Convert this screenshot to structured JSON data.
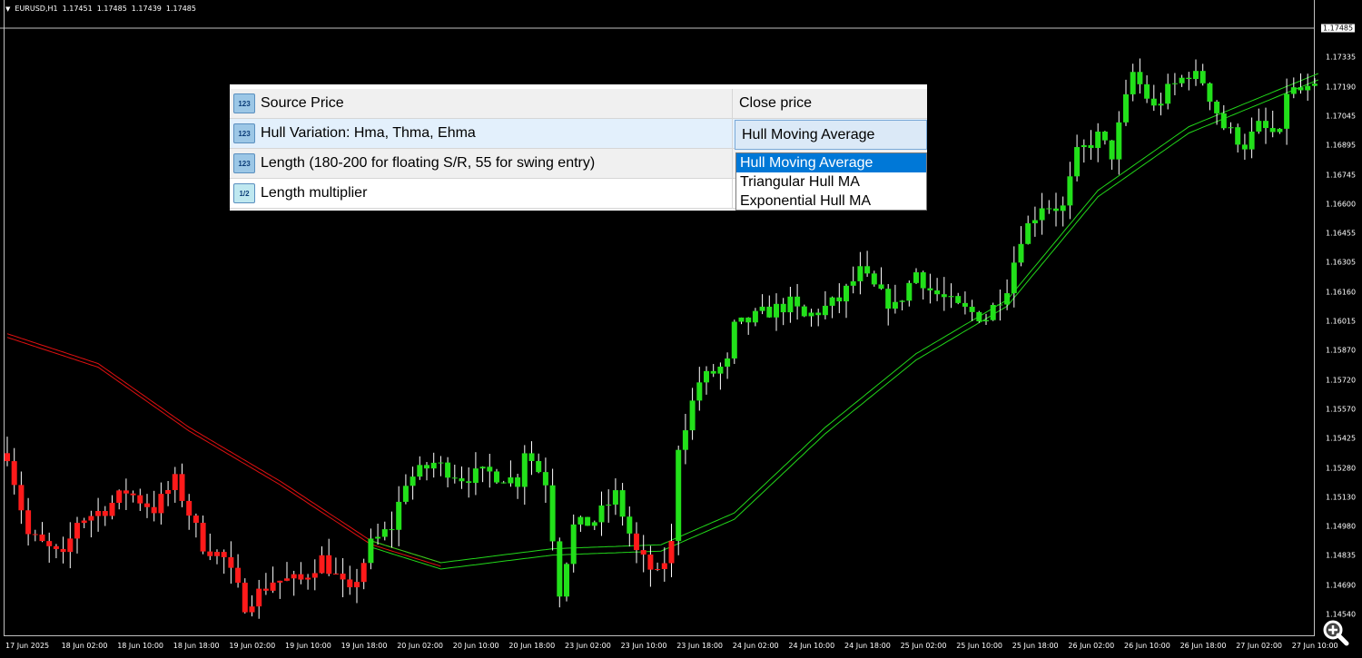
{
  "header": {
    "symbol": "EURUSD,H1",
    "open": "1.17451",
    "high": "1.17485",
    "low": "1.17439",
    "close": "1.17485"
  },
  "price_axis": {
    "current": "1.17485",
    "labels": [
      "1.17335",
      "1.17190",
      "1.17045",
      "1.16895",
      "1.16745",
      "1.16600",
      "1.16455",
      "1.16305",
      "1.16160",
      "1.16015",
      "1.15870",
      "1.15720",
      "1.15570",
      "1.15425",
      "1.15280",
      "1.15130",
      "1.14980",
      "1.14835",
      "1.14690",
      "1.14540"
    ]
  },
  "time_axis": {
    "labels": [
      "17 Jun 2025",
      "18 Jun 02:00",
      "18 Jun 10:00",
      "18 Jun 18:00",
      "19 Jun 02:00",
      "19 Jun 10:00",
      "19 Jun 18:00",
      "20 Jun 02:00",
      "20 Jun 10:00",
      "20 Jun 18:00",
      "23 Jun 02:00",
      "23 Jun 10:00",
      "23 Jun 18:00",
      "24 Jun 02:00",
      "24 Jun 10:00",
      "24 Jun 18:00",
      "25 Jun 02:00",
      "25 Jun 10:00",
      "25 Jun 18:00",
      "26 Jun 02:00",
      "26 Jun 10:00",
      "26 Jun 18:00",
      "27 Jun 02:00",
      "27 Jun 10:00"
    ]
  },
  "colors": {
    "bull": "#22e01a",
    "bear": "#ff1a1a",
    "hma_up": "#22d81a",
    "hma_down": "#e01010",
    "accent": "#0078d7"
  },
  "chart_data": {
    "type": "candlestick",
    "symbol": "EURUSD",
    "timeframe": "H1",
    "ylim": [
      1.1439,
      1.17485
    ],
    "close_path": [
      [
        0,
        1.1535
      ],
      [
        3,
        1.1494
      ],
      [
        8,
        1.1482
      ],
      [
        10,
        1.1501
      ],
      [
        14,
        1.1507
      ],
      [
        17,
        1.1516
      ],
      [
        21,
        1.1507
      ],
      [
        24,
        1.1521
      ],
      [
        28,
        1.1489
      ],
      [
        31,
        1.1482
      ],
      [
        34,
        1.1459
      ],
      [
        38,
        1.1471
      ],
      [
        42,
        1.1471
      ],
      [
        45,
        1.1482
      ],
      [
        49,
        1.1464
      ],
      [
        52,
        1.1489
      ],
      [
        55,
        1.1498
      ],
      [
        57,
        1.1521
      ],
      [
        61,
        1.153
      ],
      [
        65,
        1.1523
      ],
      [
        69,
        1.1525
      ],
      [
        73,
        1.1521
      ],
      [
        74,
        1.1537
      ],
      [
        77,
        1.1521
      ],
      [
        79,
        1.1466
      ],
      [
        81,
        1.1498
      ],
      [
        84,
        1.1501
      ],
      [
        87,
        1.1514
      ],
      [
        90,
        1.1485
      ],
      [
        93,
        1.1473
      ],
      [
        95,
        1.1489
      ],
      [
        96,
        1.1539
      ],
      [
        99,
        1.1571
      ],
      [
        103,
        1.158
      ],
      [
        104,
        1.1598
      ],
      [
        108,
        1.1605
      ],
      [
        112,
        1.161
      ],
      [
        114,
        1.1603
      ],
      [
        117,
        1.1608
      ],
      [
        119,
        1.1612
      ],
      [
        122,
        1.1626
      ],
      [
        125,
        1.1614
      ],
      [
        127,
        1.1608
      ],
      [
        130,
        1.1626
      ],
      [
        132,
        1.1617
      ],
      [
        136,
        1.1608
      ],
      [
        140,
        1.1603
      ],
      [
        143,
        1.1619
      ],
      [
        145,
        1.1644
      ],
      [
        148,
        1.166
      ],
      [
        151,
        1.1658
      ],
      [
        153,
        1.1685
      ],
      [
        156,
        1.1694
      ],
      [
        158,
        1.1685
      ],
      [
        161,
        1.1726
      ],
      [
        164,
        1.1708
      ],
      [
        166,
        1.1717
      ],
      [
        169,
        1.1726
      ],
      [
        171,
        1.1722
      ],
      [
        174,
        1.1699
      ],
      [
        177,
        1.169
      ],
      [
        179,
        1.1699
      ],
      [
        182,
        1.1694
      ],
      [
        183,
        1.1717
      ],
      [
        186,
        1.1717
      ],
      [
        187,
        1.1717
      ]
    ],
    "bear_ranges": [
      [
        0,
        51
      ],
      [
        90,
        95
      ]
    ],
    "hma_down": [
      [
        0,
        1.1595
      ],
      [
        13,
        1.158
      ],
      [
        26,
        1.1548
      ],
      [
        39,
        1.1521
      ],
      [
        52,
        1.1491
      ],
      [
        62,
        1.148
      ]
    ],
    "hma_up": [
      [
        52,
        1.1491
      ],
      [
        62,
        1.148
      ],
      [
        78,
        1.1487
      ],
      [
        93.5,
        1.1489
      ],
      [
        104,
        1.1505
      ],
      [
        117,
        1.1548
      ],
      [
        130,
        1.1585
      ],
      [
        143,
        1.1612
      ],
      [
        156,
        1.1667
      ],
      [
        169,
        1.1699
      ],
      [
        187.7,
        1.1726
      ]
    ]
  },
  "dialog": {
    "rows": [
      {
        "icon": "123",
        "name": "Source Price",
        "value": "Close price"
      },
      {
        "icon": "123",
        "name": "Hull Variation: Hma, Thma, Ehma",
        "value": "Hull Moving Average"
      },
      {
        "icon": "123",
        "name": "Length (180-200 for floating S/R, 55 for swing entry)",
        "value": ""
      },
      {
        "icon": "1/2",
        "name": "Length multiplier",
        "value": ""
      }
    ],
    "dropdown_options": [
      "Hull Moving Average",
      "Triangular Hull MA",
      "Exponential Hull MA"
    ]
  }
}
